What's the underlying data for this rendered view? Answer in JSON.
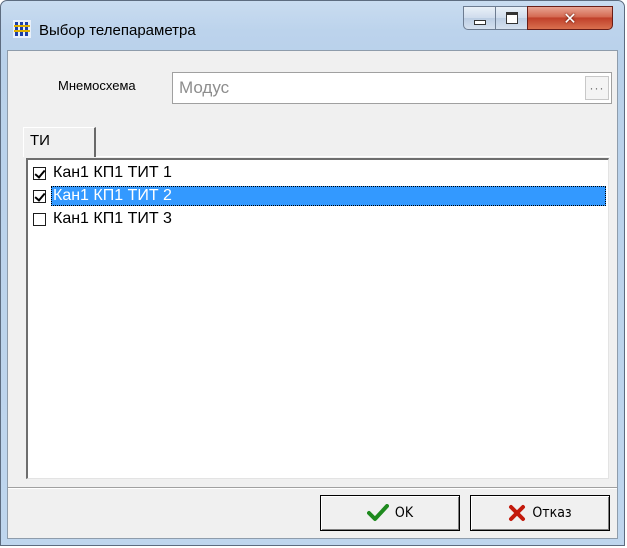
{
  "window": {
    "title": "Выбор телепараметра",
    "icon": "app-grid-icon",
    "controls": {
      "minimize": "minimize-icon",
      "maximize": "maximize-icon",
      "close": "✕"
    }
  },
  "mnemoscheme": {
    "label": "Мнемосхема",
    "value": "Модус",
    "browse_label": "···"
  },
  "tabs": [
    {
      "label": "ТИ",
      "active": true
    }
  ],
  "list": {
    "items": [
      {
        "label": "Кан1 КП1 ТИТ 1",
        "checked": true,
        "selected": false
      },
      {
        "label": "Кан1 КП1 ТИТ 2",
        "checked": true,
        "selected": true
      },
      {
        "label": "Кан1 КП1 ТИТ 3",
        "checked": false,
        "selected": false
      }
    ]
  },
  "buttons": {
    "ok": {
      "label": "OK",
      "icon": "checkmark-icon"
    },
    "cancel": {
      "label": "Отказ",
      "icon": "cross-icon"
    }
  },
  "colors": {
    "selection": "#3399ff",
    "ok_icon": "#1e8a1e",
    "cancel_icon": "#c31a0c",
    "close_button": "#c94a33"
  }
}
